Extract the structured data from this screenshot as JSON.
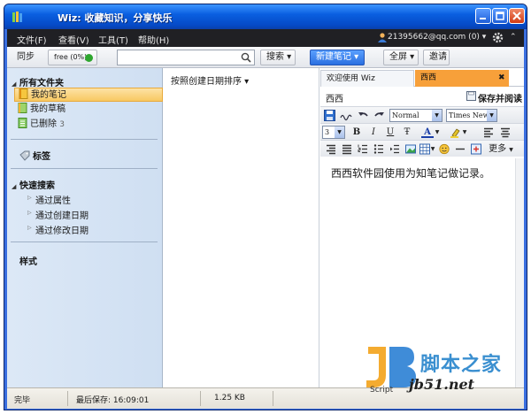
{
  "window": {
    "title": "Wiz: 收藏知识，分享快乐"
  },
  "menu": {
    "items": [
      "文件(F)",
      "查看(V)",
      "工具(T)",
      "帮助(H)"
    ],
    "account": "21395662@qq.com  (0) ▾"
  },
  "toolbar": {
    "sync": "同步",
    "storage": "free (0%)",
    "search_placeholder": "",
    "search": "搜索 ▾",
    "new_note": "新建笔记 ▾",
    "fullscreen": "全屏 ▾",
    "invite": "邀请"
  },
  "sidebar": {
    "all_folders": "所有文件夹",
    "folders": [
      {
        "label": "我的笔记",
        "selected": true
      },
      {
        "label": "我的草稿",
        "selected": false
      },
      {
        "label": "已删除",
        "count": "3",
        "selected": false
      }
    ],
    "tags": "标签",
    "quick_search": "快速搜索",
    "quick_items": [
      "通过属性",
      "通过创建日期",
      "通过修改日期"
    ],
    "styles": "样式"
  },
  "notelist": {
    "sort": "按照创建日期排序 ▾"
  },
  "editor": {
    "tabs": [
      {
        "label": "欢迎使用 Wiz",
        "active": false
      },
      {
        "label": "西西",
        "active": true
      }
    ],
    "tab_close": "✖",
    "note_title": "西西",
    "save_read": "保存并阅读",
    "format": {
      "style": "Normal",
      "font": "Times New",
      "size": "3",
      "bold": "B",
      "italic": "I",
      "underline": "U",
      "strike": "Ŧ",
      "font_color": "A",
      "more": "更多"
    },
    "body": "西西软件园使用为知笔记做记录。"
  },
  "status": {
    "state": "完毕",
    "last_saved_label": "最后保存: 16:09:01",
    "size": "1.25 KB"
  },
  "watermark": {
    "site": "脚本之家",
    "url": "jb51.net",
    "script": "Script"
  },
  "colors": {
    "accent_tab": "#f7a03a",
    "titlebar": "#0a5fe0",
    "sidebar": "#dce8f6"
  }
}
